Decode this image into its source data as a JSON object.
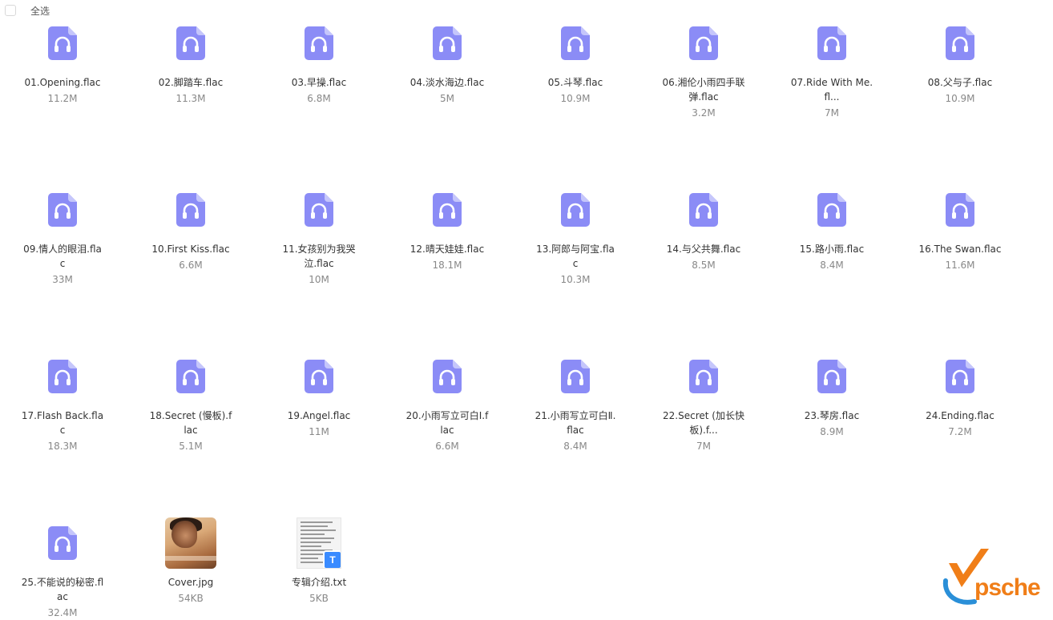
{
  "toolbar": {
    "select_all_label": "全选"
  },
  "colors": {
    "audio_icon": "#8b8cf6",
    "audio_icon_fold": "#c5c6fb",
    "name_text": "#333333",
    "size_text": "#888888",
    "watermark_orange": "#f07e18",
    "watermark_blue": "#2a8fd8"
  },
  "files": [
    {
      "name": "01.Opening.flac",
      "size": "11.2M",
      "icon": "audio-file-icon"
    },
    {
      "name": "02.脚踏车.flac",
      "size": "11.3M",
      "icon": "audio-file-icon"
    },
    {
      "name": "03.早操.flac",
      "size": "6.8M",
      "icon": "audio-file-icon"
    },
    {
      "name": "04.淡水海边.flac",
      "size": "5M",
      "icon": "audio-file-icon"
    },
    {
      "name": "05.斗琴.flac",
      "size": "10.9M",
      "icon": "audio-file-icon"
    },
    {
      "name": "06.湘伦小雨四手联弹.flac",
      "size": "3.2M",
      "icon": "audio-file-icon"
    },
    {
      "name": "07.Ride With Me.fl...",
      "size": "7M",
      "icon": "audio-file-icon"
    },
    {
      "name": "08.父与子.flac",
      "size": "10.9M",
      "icon": "audio-file-icon"
    },
    {
      "name": "09.情人的眼泪.flac",
      "size": "33M",
      "icon": "audio-file-icon"
    },
    {
      "name": "10.First Kiss.flac",
      "size": "6.6M",
      "icon": "audio-file-icon"
    },
    {
      "name": "11.女孩别为我哭泣.flac",
      "size": "10M",
      "icon": "audio-file-icon"
    },
    {
      "name": "12.晴天娃娃.flac",
      "size": "18.1M",
      "icon": "audio-file-icon"
    },
    {
      "name": "13.阿郎与阿宝.flac",
      "size": "10.3M",
      "icon": "audio-file-icon"
    },
    {
      "name": "14.与父共舞.flac",
      "size": "8.5M",
      "icon": "audio-file-icon"
    },
    {
      "name": "15.路小雨.flac",
      "size": "8.4M",
      "icon": "audio-file-icon"
    },
    {
      "name": "16.The Swan.flac",
      "size": "11.6M",
      "icon": "audio-file-icon"
    },
    {
      "name": "17.Flash Back.flac",
      "size": "18.3M",
      "icon": "audio-file-icon"
    },
    {
      "name": "18.Secret (慢板).flac",
      "size": "5.1M",
      "icon": "audio-file-icon"
    },
    {
      "name": "19.Angel.flac",
      "size": "11M",
      "icon": "audio-file-icon"
    },
    {
      "name": "20.小雨写立可白Ⅰ.flac",
      "size": "6.6M",
      "icon": "audio-file-icon"
    },
    {
      "name": "21.小雨写立可白Ⅱ.flac",
      "size": "8.4M",
      "icon": "audio-file-icon"
    },
    {
      "name": "22.Secret (加长快板).f...",
      "size": "7M",
      "icon": "audio-file-icon"
    },
    {
      "name": "23.琴房.flac",
      "size": "8.9M",
      "icon": "audio-file-icon"
    },
    {
      "name": "24.Ending.flac",
      "size": "7.2M",
      "icon": "audio-file-icon"
    },
    {
      "name": "25.不能说的秘密.flac",
      "size": "32.4M",
      "icon": "audio-file-icon"
    },
    {
      "name": "Cover.jpg",
      "size": "54KB",
      "icon": "image-thumbnail"
    },
    {
      "name": "专辑介绍.txt",
      "size": "5KB",
      "icon": "text-file-thumbnail"
    }
  ],
  "watermark": {
    "text": "psche"
  }
}
